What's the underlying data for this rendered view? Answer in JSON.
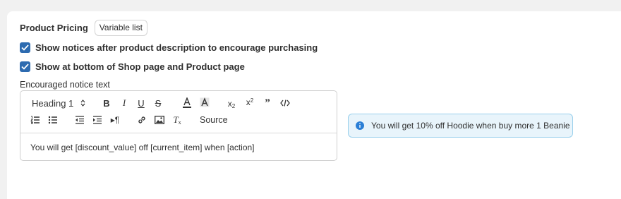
{
  "pricing": {
    "label": "Product Pricing",
    "variable_list_label": "Variable list"
  },
  "checkboxes": [
    {
      "label": "Show notices after product description to encourage purchasing",
      "checked": true
    },
    {
      "label": "Show at bottom of Shop page and Product page",
      "checked": true
    }
  ],
  "editor": {
    "label": "Encouraged notice text",
    "heading_value": "Heading 1",
    "source_label": "Source",
    "content": "You will get [discount_value] off [current_item] when [action]"
  },
  "notice": {
    "text": "You will get 10% off Hoodie when buy more 1 Beanie",
    "accent": "#2b7fd6",
    "background": "#e8f4fb"
  },
  "colors": {
    "checkbox": "#2d6bb0"
  },
  "toolbar_icons": [
    "bold-icon",
    "italic-icon",
    "underline-icon",
    "strikethrough-icon",
    "text-color-icon",
    "background-color-icon",
    "subscript-icon",
    "superscript-icon",
    "blockquote-icon",
    "code-icon",
    "ordered-list-icon",
    "bullet-list-icon",
    "outdent-icon",
    "indent-icon",
    "paragraph-direction-icon",
    "link-icon",
    "image-icon",
    "clear-format-icon"
  ]
}
